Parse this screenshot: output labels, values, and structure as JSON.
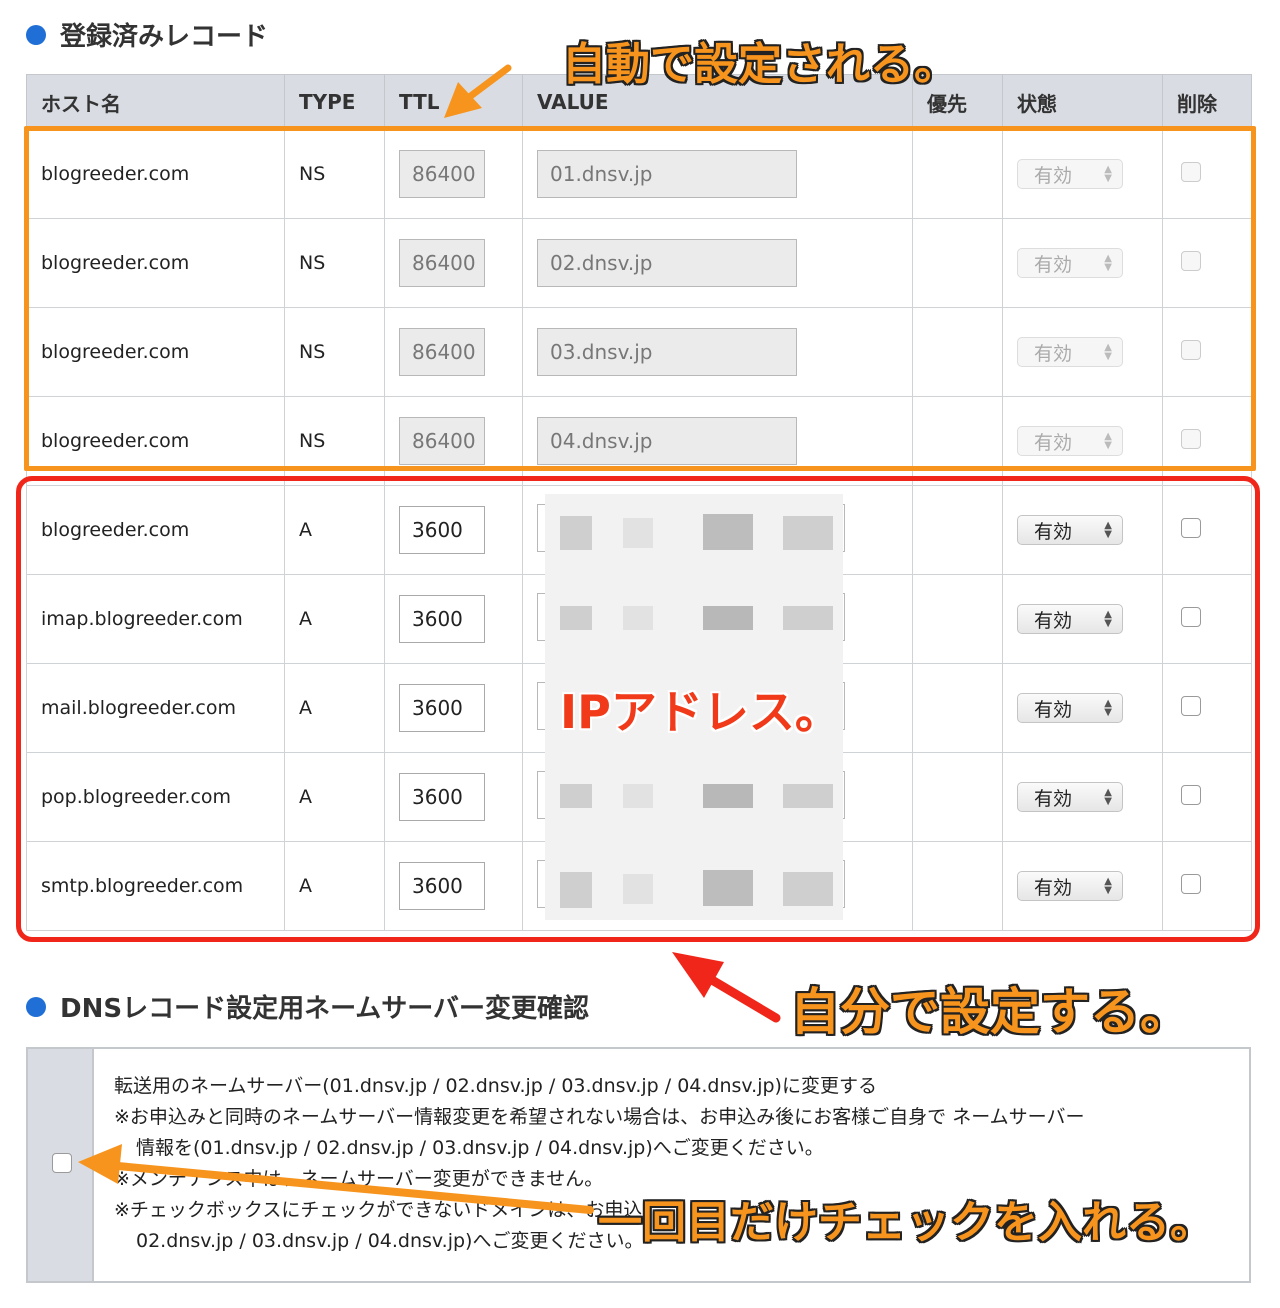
{
  "section1": {
    "title": "登録済みレコード"
  },
  "columns": {
    "host": "ホスト名",
    "type": "TYPE",
    "ttl": "TTL",
    "value": "VALUE",
    "priority": "優先",
    "status": "状態",
    "delete": "削除"
  },
  "rows": [
    {
      "host": "blogreeder.com",
      "type": "NS",
      "ttl": "86400",
      "value": "01.dnsv.jp",
      "status": "有効",
      "editable": false
    },
    {
      "host": "blogreeder.com",
      "type": "NS",
      "ttl": "86400",
      "value": "02.dnsv.jp",
      "status": "有効",
      "editable": false
    },
    {
      "host": "blogreeder.com",
      "type": "NS",
      "ttl": "86400",
      "value": "03.dnsv.jp",
      "status": "有効",
      "editable": false
    },
    {
      "host": "blogreeder.com",
      "type": "NS",
      "ttl": "86400",
      "value": "04.dnsv.jp",
      "status": "有効",
      "editable": false
    },
    {
      "host": "blogreeder.com",
      "type": "A",
      "ttl": "3600",
      "value": "",
      "status": "有効",
      "editable": true
    },
    {
      "host": "imap.blogreeder.com",
      "type": "A",
      "ttl": "3600",
      "value": "",
      "status": "有効",
      "editable": true
    },
    {
      "host": "mail.blogreeder.com",
      "type": "A",
      "ttl": "3600",
      "value": "",
      "status": "有効",
      "editable": true
    },
    {
      "host": "pop.blogreeder.com",
      "type": "A",
      "ttl": "3600",
      "value": "",
      "status": "有効",
      "editable": true
    },
    {
      "host": "smtp.blogreeder.com",
      "type": "A",
      "ttl": "3600",
      "value": "",
      "status": "有効",
      "editable": true
    }
  ],
  "section2": {
    "title": "DNSレコード設定用ネームサーバー変更確認",
    "line1": "転送用のネームサーバー(01.dnsv.jp / 02.dnsv.jp / 03.dnsv.jp / 04.dnsv.jp)に変更する",
    "line2": "※お申込みと同時のネームサーバー情報変更を希望されない場合は、お申込み後にお客様ご自身で ネームサーバー",
    "line3": "情報を(01.dnsv.jp / 02.dnsv.jp / 03.dnsv.jp / 04.dnsv.jp)へご変更ください。",
    "line4": "※メンテナンス中は、ネームサーバー変更ができません。",
    "line5": "※チェックボックスにチェックができないドメインは、お申込",
    "line6": "02.dnsv.jp / 03.dnsv.jp / 04.dnsv.jp)へご変更ください。"
  },
  "annotations": {
    "auto": "自動で設定される。",
    "ip": "IPアドレス。",
    "manual": "自分で設定する。",
    "firstTime": "一回目だけチェックを入れる。"
  },
  "colors": {
    "orange": "#f7941d",
    "red": "#f0261a",
    "header_bg": "#d9dde3",
    "accent": "#1f6fd6"
  }
}
